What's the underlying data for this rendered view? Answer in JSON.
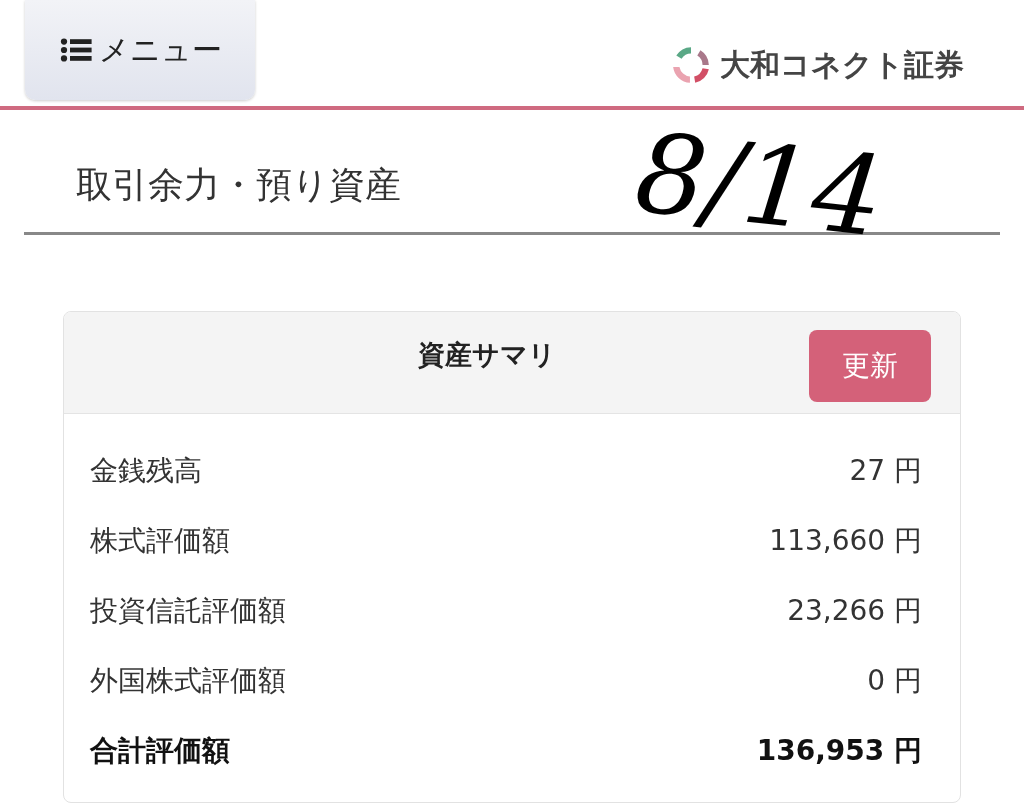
{
  "header": {
    "menu_button": "メニュー",
    "logo": "大和コネクト証券"
  },
  "page_title": "取引余力・預り資産",
  "annotation": "8/14",
  "summary": {
    "title": "資産サマリ",
    "refresh_button": "更新",
    "rows": [
      {
        "kind": "item",
        "label": "金銭残高",
        "value": "27 円"
      },
      {
        "kind": "item",
        "label": "株式評価額",
        "value": "113,660 円"
      },
      {
        "kind": "item",
        "label": "投資信託評価額",
        "value": "23,266 円"
      },
      {
        "kind": "item",
        "label": "外国株式評価額",
        "value": "0 円"
      },
      {
        "kind": "total",
        "label": "合計評価額",
        "value": "136,953 円"
      }
    ]
  }
}
